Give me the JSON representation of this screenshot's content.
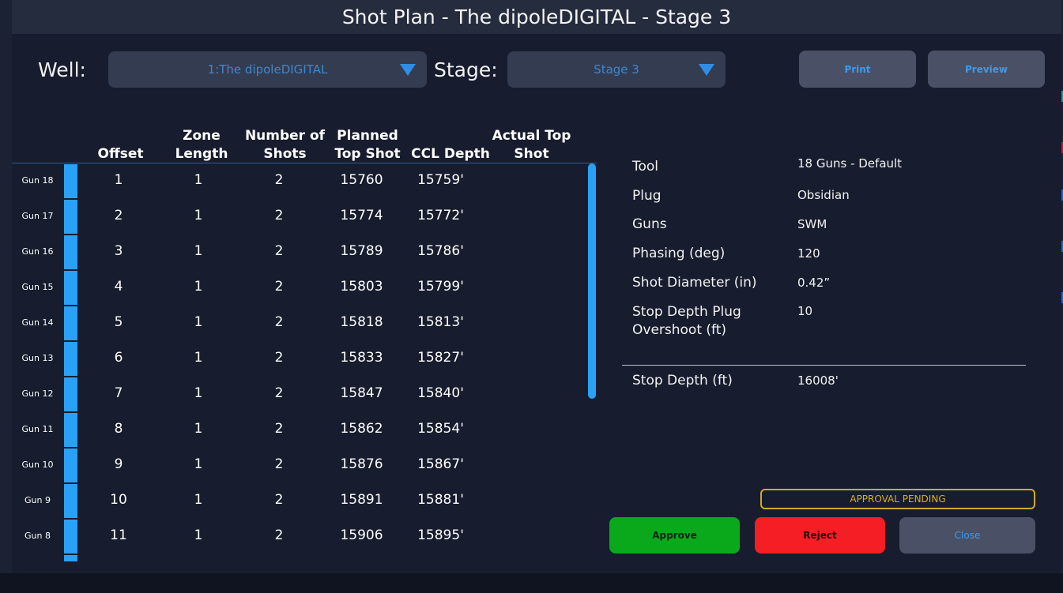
{
  "dialog": {
    "title": "Shot Plan - The dipoleDIGITAL - Stage 3"
  },
  "well": {
    "label": "Well:",
    "value": "1:The dipoleDIGITAL"
  },
  "stage": {
    "label": "Stage:",
    "value": "Stage 3"
  },
  "toolbar": {
    "print_label": "Print",
    "preview_label": "Preview"
  },
  "table": {
    "columns": {
      "offset": "Offset",
      "zone_length": "Zone Length",
      "number_of_shots": "Number of Shots",
      "planned_top_shot": "Planned Top Shot",
      "ccl_depth": "CCL Depth",
      "actual_top_shot": "Actual Top Shot"
    },
    "rows": [
      {
        "gun": "Gun 18",
        "offset": "1",
        "zone_length": "1",
        "shots": "2",
        "planned": "15760",
        "ccl": "15759'"
      },
      {
        "gun": "Gun 17",
        "offset": "2",
        "zone_length": "1",
        "shots": "2",
        "planned": "15774",
        "ccl": "15772'"
      },
      {
        "gun": "Gun 16",
        "offset": "3",
        "zone_length": "1",
        "shots": "2",
        "planned": "15789",
        "ccl": "15786'"
      },
      {
        "gun": "Gun 15",
        "offset": "4",
        "zone_length": "1",
        "shots": "2",
        "planned": "15803",
        "ccl": "15799'"
      },
      {
        "gun": "Gun 14",
        "offset": "5",
        "zone_length": "1",
        "shots": "2",
        "planned": "15818",
        "ccl": "15813'"
      },
      {
        "gun": "Gun 13",
        "offset": "6",
        "zone_length": "1",
        "shots": "2",
        "planned": "15833",
        "ccl": "15827'"
      },
      {
        "gun": "Gun 12",
        "offset": "7",
        "zone_length": "1",
        "shots": "2",
        "planned": "15847",
        "ccl": "15840'"
      },
      {
        "gun": "Gun 11",
        "offset": "8",
        "zone_length": "1",
        "shots": "2",
        "planned": "15862",
        "ccl": "15854'"
      },
      {
        "gun": "Gun 10",
        "offset": "9",
        "zone_length": "1",
        "shots": "2",
        "planned": "15876",
        "ccl": "15867'"
      },
      {
        "gun": "Gun 9",
        "offset": "10",
        "zone_length": "1",
        "shots": "2",
        "planned": "15891",
        "ccl": "15881'"
      },
      {
        "gun": "Gun 8",
        "offset": "11",
        "zone_length": "1",
        "shots": "2",
        "planned": "15906",
        "ccl": "15895'"
      }
    ]
  },
  "properties": {
    "tool": {
      "label": "Tool",
      "value": "18 Guns - Default"
    },
    "plug": {
      "label": "Plug",
      "value": "Obsidian"
    },
    "guns": {
      "label": "Guns",
      "value": "SWM"
    },
    "phasing": {
      "label": "Phasing (deg)",
      "value": "120"
    },
    "shot_diameter": {
      "label": "Shot Diameter (in)",
      "value": "0.42”"
    },
    "overshoot": {
      "label": "Stop Depth Plug Overshoot (ft)",
      "value": "10"
    },
    "stop_depth": {
      "label": "Stop Depth (ft)",
      "value": "16008'"
    }
  },
  "status": {
    "text": "APPROVAL PENDING"
  },
  "actions": {
    "approve": "Approve",
    "reject": "Reject",
    "close": "Close"
  },
  "colors": {
    "accent": "#29a1f7",
    "approve": "#0aa91c",
    "reject": "#f51e24",
    "pending": "#d2a92a"
  }
}
